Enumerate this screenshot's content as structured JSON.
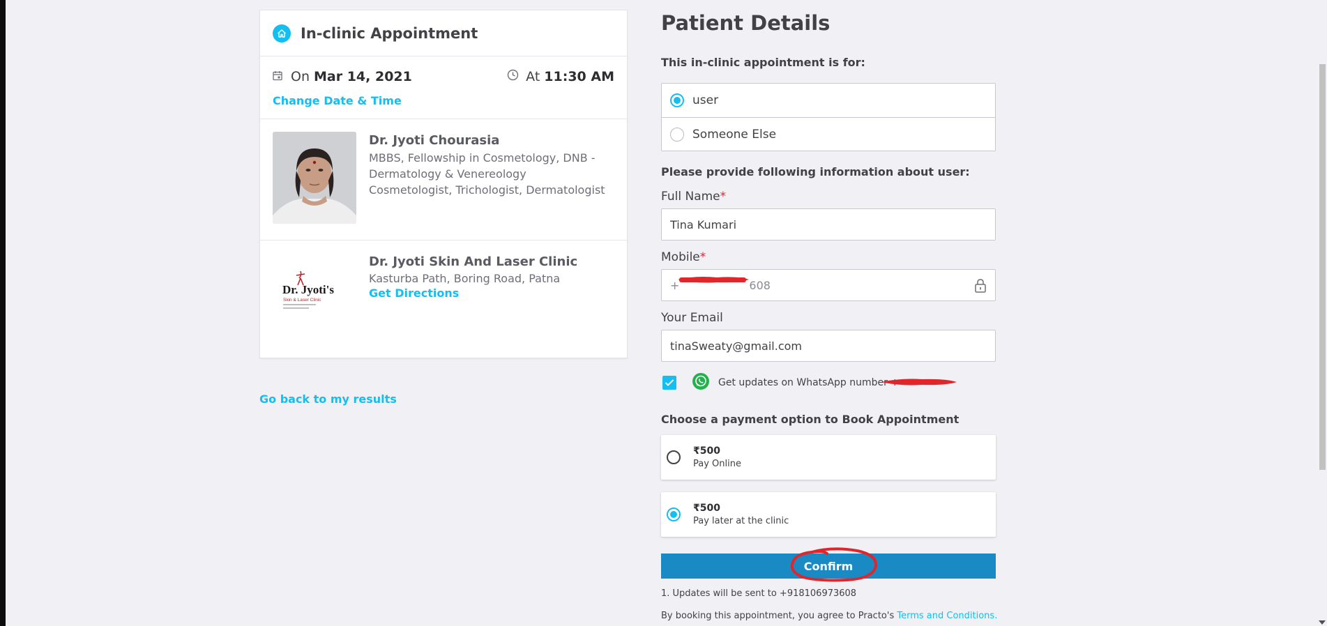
{
  "appointment": {
    "title": "In-clinic Appointment",
    "date_prefix": "On",
    "date": "Mar 14, 2021",
    "time_prefix": "At",
    "time": "11:30 AM",
    "change_link": "Change Date & Time"
  },
  "doctor": {
    "name": "Dr. Jyoti Chourasia",
    "qualification_line1": "MBBS, Fellowship in Cosmetology, DNB -",
    "qualification_line2": "Dermatology & Venereology",
    "specialities": "Cosmetologist, Trichologist, Dermatologist"
  },
  "clinic": {
    "name": "Dr. Jyoti Skin And Laser Clinic",
    "address": "Kasturba Path, Boring Road, Patna",
    "directions_link": "Get Directions",
    "logo_text": "Dr. Jyoti's",
    "logo_subtext": "Skin & Laser Clinic"
  },
  "back_link": "Go back to my results",
  "patient": {
    "title": "Patient Details",
    "for_label": "This in-clinic appointment is for:",
    "options": [
      "user",
      "Someone Else"
    ],
    "selected_option": "user",
    "info_label": "Please provide following information about user:",
    "full_name_label": "Full Name",
    "full_name_value": "Tina Kumari",
    "mobile_label": "Mobile",
    "mobile_value_start": "+",
    "mobile_value_end": "608",
    "email_label": "Your Email",
    "email_value": "tinaSweaty@gmail.com",
    "whatsapp_text": "Get updates on WhatsApp number +",
    "whatsapp_checked": true,
    "required_mark": "*"
  },
  "payment": {
    "label": "Choose a payment option to Book Appointment",
    "options": [
      {
        "amount": "₹500",
        "description": "Pay Online",
        "selected": false
      },
      {
        "amount": "₹500",
        "description": "Pay later at the clinic",
        "selected": true
      }
    ],
    "confirm_label": "Confirm"
  },
  "footer": {
    "update_note": "1.  Updates will be sent to +918106973608",
    "agree_prefix": "By booking this appointment, you agree to Practo's ",
    "terms_link": "Terms and Conditions."
  },
  "colors": {
    "accent": "#14bef0",
    "confirm_button": "#1a8ac4",
    "annotation_red": "#e0262a",
    "background": "#f0f0f5"
  }
}
